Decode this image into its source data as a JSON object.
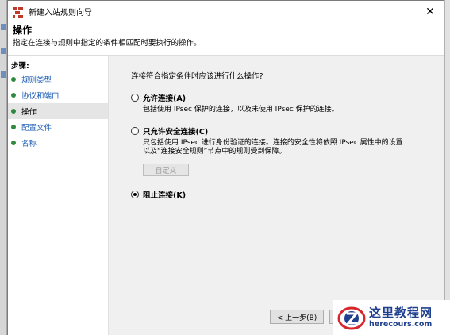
{
  "window": {
    "title": "新建入站规则向导",
    "close_glyph": "✕"
  },
  "header": {
    "title": "操作",
    "description": "指定在连接与规则中指定的条件相匹配时要执行的操作。"
  },
  "steps": {
    "heading": "步骤:",
    "items": [
      {
        "label": "规则类型",
        "active": false
      },
      {
        "label": "协议和端口",
        "active": false
      },
      {
        "label": "操作",
        "active": true
      },
      {
        "label": "配置文件",
        "active": false
      },
      {
        "label": "名称",
        "active": false
      }
    ]
  },
  "main": {
    "question": "连接符合指定条件时应该进行什么操作?",
    "options": [
      {
        "label": "允许连接(A)",
        "description": "包括使用 IPsec 保护的连接，以及未使用 IPsec 保护的连接。",
        "checked": false
      },
      {
        "label": "只允许安全连接(C)",
        "description": "只包括使用 IPsec 进行身份验证的连接。连接的安全性将依照 IPsec 属性中的设置以及“连接安全规则”节点中的规则受到保障。",
        "checked": false
      },
      {
        "label": "阻止连接(K)",
        "description": "",
        "checked": true
      }
    ],
    "custom_button": "自定义"
  },
  "footer": {
    "back_label": "< 上一步(B)",
    "next_label": "下"
  },
  "watermark": {
    "name": "这里教程网",
    "url": "herecours.com",
    "colors": {
      "blue": "#1f3f8f",
      "red": "#d8262c"
    }
  }
}
